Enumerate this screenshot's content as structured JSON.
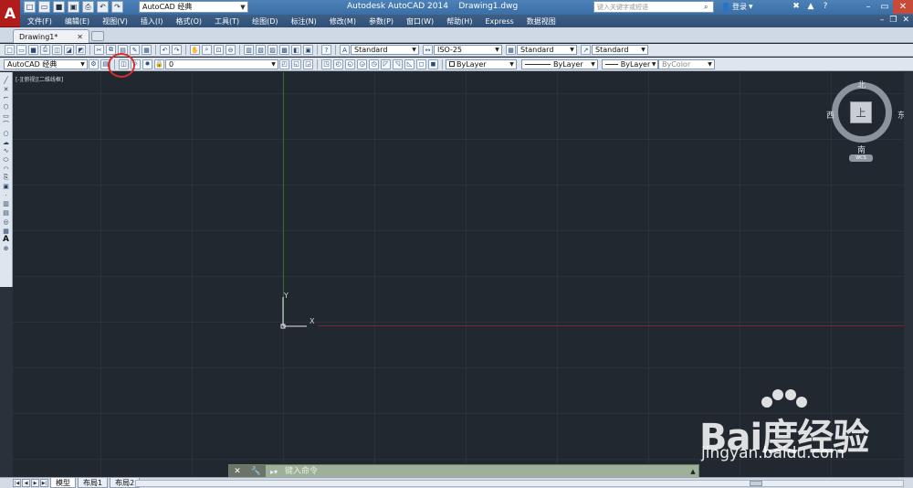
{
  "titlebar": {
    "logo": "A",
    "workspace": "AutoCAD 经典",
    "title": "Autodesk AutoCAD 2014    Drawing1.dwg",
    "search_placeholder": "键入关键字或短语",
    "login": "登录",
    "quick_access_icons": [
      "new-icon",
      "open-icon",
      "save-icon",
      "save-as-icon",
      "print-icon",
      "undo-icon",
      "redo-icon"
    ]
  },
  "menubar": {
    "items": [
      "文件(F)",
      "编辑(E)",
      "视图(V)",
      "插入(I)",
      "格式(O)",
      "工具(T)",
      "绘图(D)",
      "标注(N)",
      "修改(M)",
      "参数(P)",
      "窗口(W)",
      "帮助(H)",
      "Express",
      "数据视图"
    ]
  },
  "tabs": {
    "document": "Drawing1*"
  },
  "toolbar": {
    "text_style": "Standard",
    "dim_style": "ISO-25",
    "table_style": "Standard",
    "multileader_style": "Standard",
    "workspace_combo": "AutoCAD 经典",
    "layer": "0",
    "color": "ByLayer",
    "linetype": "ByLayer",
    "lineweight": "ByLayer",
    "plotstyle": "ByColor"
  },
  "canvas": {
    "viewport_label": "[-][俯视][二维线框]",
    "ucs_x": "X",
    "ucs_y": "Y"
  },
  "viewcube": {
    "top": "上",
    "north": "北",
    "south": "南",
    "west": "西",
    "east": "东",
    "wcs": "WCS"
  },
  "commandline": {
    "placeholder": "键入命令"
  },
  "layout_tabs": [
    "模型",
    "布局1",
    "布局2"
  ],
  "watermark": {
    "logo": "Bai度经验",
    "url": "jingyan.baidu.com"
  }
}
